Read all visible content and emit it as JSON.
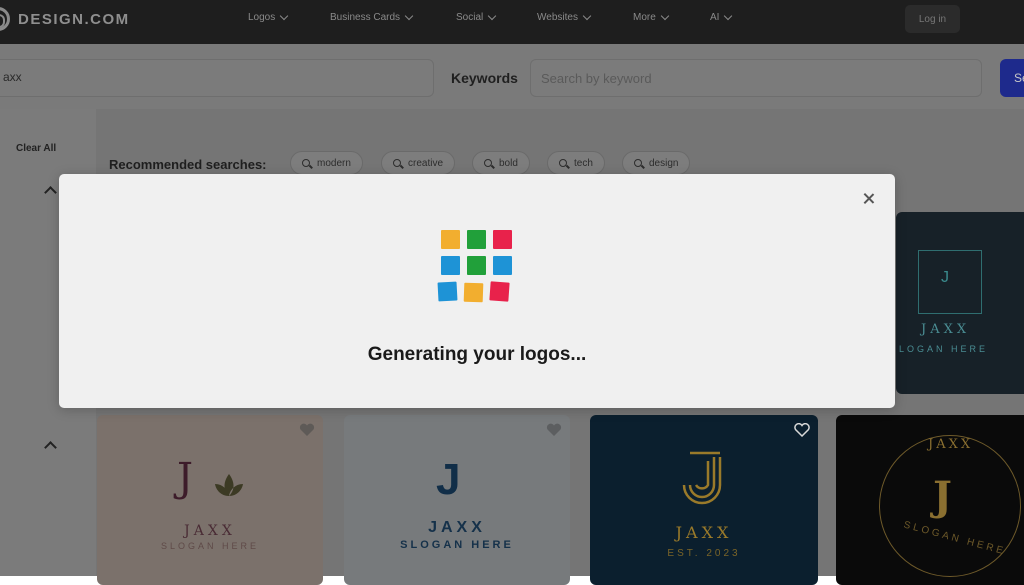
{
  "header": {
    "brand": "DESIGN.COM",
    "nav": [
      {
        "label": "Logos"
      },
      {
        "label": "Business Cards"
      },
      {
        "label": "Social"
      },
      {
        "label": "Websites"
      },
      {
        "label": "More"
      },
      {
        "label": "AI"
      }
    ],
    "login_label": "Log in"
  },
  "search": {
    "query_value": "axx",
    "keywords_label": "Keywords",
    "keywords_placeholder": "Search by keyword",
    "button_label": "Se"
  },
  "sidebar": {
    "clear_all": "Clear All"
  },
  "recommended": {
    "label": "Recommended searches:",
    "chips": [
      "modern",
      "creative",
      "bold",
      "tech",
      "design"
    ]
  },
  "cards": [
    {
      "title": "JAXX",
      "slogan": "SLOGAN HERE"
    },
    {
      "title": "JAXX",
      "slogan": "SLOGAN HERE"
    },
    {
      "title": "JAXX",
      "slogan": "SLOGAN HERE"
    },
    {
      "title": "JAXX",
      "slogan": "EST. 2023"
    },
    {
      "title": "JAXX",
      "slogan": "SLOGAN HERE"
    }
  ],
  "modal": {
    "message": "Generating your logos...",
    "tile_colors": [
      "#f2ae2f",
      "#21a03a",
      "#e8224b",
      "#1e93d6",
      "#21a03a",
      "#1e93d6",
      "#1e93d6",
      "#f2ae2f",
      "#e8224b"
    ]
  },
  "colors": {
    "dim_overlay": "#7a7a7a",
    "topbar": "#1e1e1e",
    "search_button": "#1e2a8c"
  }
}
